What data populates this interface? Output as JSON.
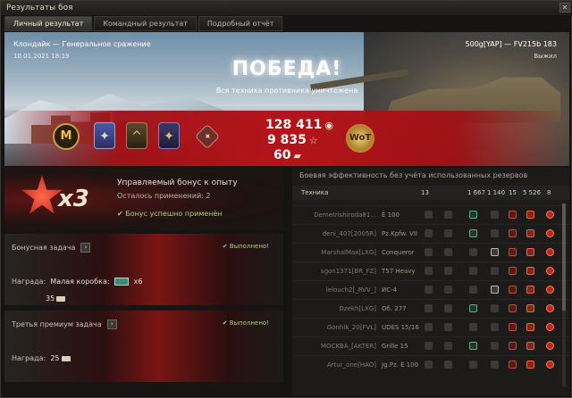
{
  "window": {
    "title": "Результаты боя"
  },
  "tabs": [
    "Личный результат",
    "Командный результат",
    "Подробный отчёт"
  ],
  "banner": {
    "map": "Клондайк — Генеральное сражение",
    "datetime": "10.01.2021 18:19",
    "player": "500g[YAP] — FV215b 183",
    "player_status": "Выжил",
    "result": "ПОБЕДА!",
    "result_sub": "Вся техника противника уничтожена"
  },
  "earnings": {
    "credits": "128 411",
    "xp": "9 835",
    "free_xp": "60"
  },
  "medals": [
    "M",
    "✦",
    "^",
    "✦",
    "✦"
  ],
  "bonus": {
    "multiplier": "x3",
    "title": "Управляемый бонус к опыту",
    "remaining": "Осталось применений: 2",
    "applied": "✔ Бонус успешно применён"
  },
  "tasks": [
    {
      "title": "Бонусная задача",
      "status": "✔ Выполнено!",
      "reward_label": "Награда:",
      "reward_item": "Малая коробка:",
      "reward_count": "x6",
      "reward_extra": "35"
    },
    {
      "title": "Третья премиум задача",
      "status": "✔ Выполнено!",
      "reward_label": "Награда:",
      "reward_extra": "25"
    }
  ],
  "team_panel": {
    "title": "Боевая эффективность без учёта использованных резервов",
    "headers": [
      "Техника",
      "13",
      "",
      "1 667",
      "1 140",
      "15",
      "5 526",
      "8"
    ],
    "rows": [
      {
        "player": "Demetrishiroda81...",
        "tank": "E 100"
      },
      {
        "player": "deni_407[2005R]",
        "tank": "Pz.Kpfw. VII"
      },
      {
        "player": "MarshalMax[LXG]",
        "tank": "Conqueror"
      },
      {
        "player": "sgon1371[BR_FZ]",
        "tank": "T57 Heavy"
      },
      {
        "player": "lelouch2[_RVV_]",
        "tank": "ИС-4"
      },
      {
        "player": "Dzekh[LXG]",
        "tank": "Об. 277"
      },
      {
        "player": "Gonhik_20[FVL]",
        "tank": "UDES 15/16"
      },
      {
        "player": "MOCKBA_[AKTER]",
        "tank": "Grille 15"
      },
      {
        "player": "Artur_one[HAO]",
        "tank": "Jg.Pz. E 100"
      }
    ]
  }
}
